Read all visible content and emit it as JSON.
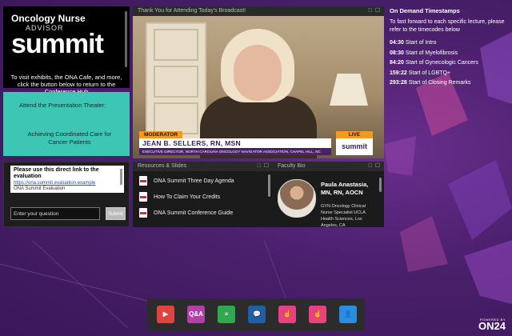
{
  "logo": {
    "brand_top": "Oncology Nurse",
    "brand_mid": "ADVISOR",
    "brand_big": "summit",
    "description": "To visit exhibits, the ONA Cafe, and more, click the button below to return to the Conference Hub"
  },
  "theater": {
    "line1": "Attend the Presentation Theater:",
    "line2": "Achieving Coordinated Care for Cancer Patients"
  },
  "qa": {
    "title": "Please use this direct link to the evaluation",
    "link": "https://ona.summit.evaluation.example",
    "sub": "ONA Summit Evaluation",
    "input_placeholder": "Enter your question",
    "submit_label": "Submit"
  },
  "video": {
    "header": "Thank You for Attending Today's Broadcast!",
    "header_controls": "□ ☐",
    "tag": "MODERATOR",
    "name": "JEAN B. SELLERS, RN, MSN",
    "role": "EXECUTIVE DIRECTOR, NORTH CAROLINA ONCOLOGY NAVIGATOR ASSOCIATION, CHAPEL HILL, NC",
    "live": "LIVE",
    "mini_logo": "summit"
  },
  "timestamps": {
    "title": "On Demand Timestamps",
    "intro": "To fast forward to each specific lecture, please refer to the timecodes below",
    "items": [
      {
        "time": "04:30",
        "label": " Start of Intro"
      },
      {
        "time": "08:30",
        "label": " Start of Myelofibrosis"
      },
      {
        "time": "84:20",
        "label": " Start of Gynecologic Cancers"
      },
      {
        "time": "159:22",
        "label": " Start of LGBTQ+"
      },
      {
        "time": "293:28",
        "label": " Start of Closing Remarks"
      }
    ]
  },
  "resources": {
    "header": "Resources & Slides",
    "items": [
      "ONA Summit Three Day Agenda",
      "How To Claim Your Credits",
      "ONA Summit Conference Guide"
    ]
  },
  "speaker": {
    "header": "Faculty Bio",
    "name": "Paula Anastasia, MN, RN, AOCN",
    "title": "GYN Oncology Clinical Nurse Specialist UCLA Health Sciences, Los Angeles, CA"
  },
  "dock": {
    "buttons": [
      {
        "name": "media-player-button",
        "icon": "▶",
        "color": "#e0443c"
      },
      {
        "name": "qa-button",
        "icon": "Q&A",
        "color": "#b43fa8"
      },
      {
        "name": "resources-button",
        "icon": "≡",
        "color": "#2fa84f"
      },
      {
        "name": "chat-button",
        "icon": "💬",
        "color": "#1f5fa8"
      },
      {
        "name": "engagement-button-1",
        "icon": "☝",
        "color": "#e8417f"
      },
      {
        "name": "engagement-button-2",
        "icon": "☝",
        "color": "#e8417f"
      },
      {
        "name": "speaker-bio-button",
        "icon": "👤",
        "color": "#2b8de0"
      }
    ]
  },
  "powered": {
    "line1": "POWERED BY",
    "line2": "ON24"
  }
}
